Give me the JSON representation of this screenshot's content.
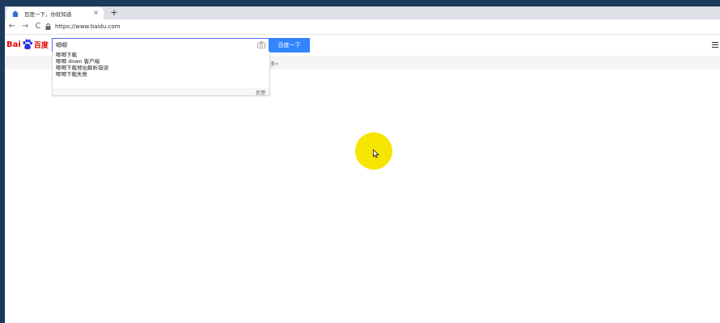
{
  "tab": {
    "title": "百度一下，你就知道",
    "close": "×",
    "new_tab": "+"
  },
  "toolbar": {
    "back": "←",
    "forward": "→",
    "reload": "C",
    "url": "https://www.baidu.com"
  },
  "logo": {
    "bai": "Bai",
    "du": "百度"
  },
  "search": {
    "value": "唧唧",
    "button_label": "百度一下"
  },
  "subnav": {
    "more": "多»"
  },
  "suggestions": {
    "items": [
      "唧唧下载",
      "唧唧 down 客户端",
      "唧唧下载地址解析错误",
      "唧唧下载失败"
    ],
    "feedback": "反馈"
  },
  "colors": {
    "accent": "#3385ff",
    "brand": "#e10602",
    "cursor_highlight": "#f6e500"
  }
}
